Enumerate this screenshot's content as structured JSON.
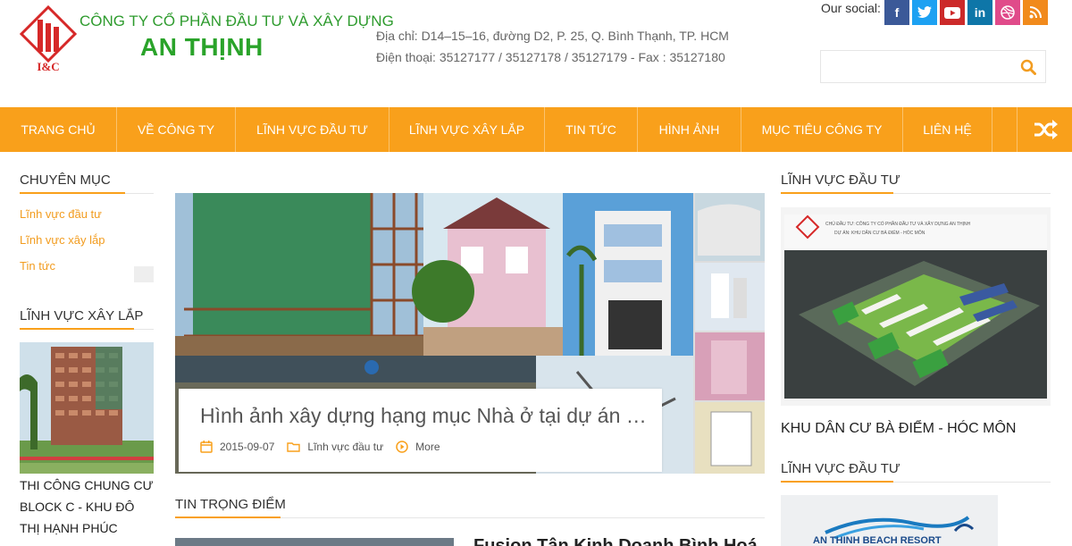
{
  "header": {
    "logo_text": "I&C",
    "company_line1": "CÔNG TY CỔ PHẦN ĐẦU TƯ VÀ XÂY DỰNG",
    "company_line2": "AN THỊNH",
    "address": "Địa chỉ: D14–15–16, đường D2, P. 25, Q. Bình Thạnh, TP. HCM",
    "phone": "Điện thoại: 35127177 / 35127178 / 35127179 - Fax : 35127180",
    "social_label": "Our social:",
    "social": [
      {
        "name": "facebook",
        "glyph": "f"
      },
      {
        "name": "twitter",
        "glyph": "t"
      },
      {
        "name": "youtube",
        "glyph": "▶"
      },
      {
        "name": "linkedin",
        "glyph": "in"
      },
      {
        "name": "dribbble",
        "glyph": "⊛"
      },
      {
        "name": "rss",
        "glyph": "◉"
      }
    ],
    "search_placeholder": ""
  },
  "nav": {
    "items": [
      {
        "label": "Trang chủ"
      },
      {
        "label": "Về công ty"
      },
      {
        "label": "Lĩnh vực đầu tư"
      },
      {
        "label": "Lĩnh vực xây lắp"
      },
      {
        "label": "Tin tức"
      },
      {
        "label": "Hình ảnh"
      },
      {
        "label": "Mục tiêu công ty"
      },
      {
        "label": "Liên hệ"
      }
    ]
  },
  "left": {
    "section1_title": "Chuyên mục",
    "categories": [
      "Lĩnh vực đầu tư",
      "Lĩnh vực xây lắp",
      "Tin tức"
    ],
    "section2_title": "Lĩnh vực xây lắp",
    "post_caption": "THI CÔNG CHUNG CƯ BLOCK C - KHU ĐÔ THỊ HẠNH PHÚC"
  },
  "slider": {
    "title": "Hình ảnh xây dựng hạng mục Nhà ở tại dự án Khu dân cư",
    "date": "2015-09-07",
    "category": "Lĩnh vực đầu tư",
    "more": "More"
  },
  "tin_trong_diem": {
    "title": "Tin trọng điểm",
    "headline": "Fusion Tân Kinh Doanh Bình Hoá"
  },
  "right": {
    "section1_title": "Lĩnh vực đầu tư",
    "post1_caption": "KHU DÂN CƯ BÀ ĐIỂM - HÓC MÔN",
    "img1_header": "CHỦ ĐẦU TƯ: CÔNG TY CỔ PHẦN ĐẦU TƯ VÀ XÂY DỰNG AN THỊNH",
    "img1_sub": "DỰ ÁN: KHU DÂN CƯ BÀ ĐIỂM - HÓC MÔN",
    "section2_title": "Lĩnh vực đầu tư",
    "img2_text": "AN THINH BEACH RESORT"
  },
  "colors": {
    "accent": "#f9a01b",
    "green": "#2aa32a",
    "link": "#f29c1f"
  }
}
